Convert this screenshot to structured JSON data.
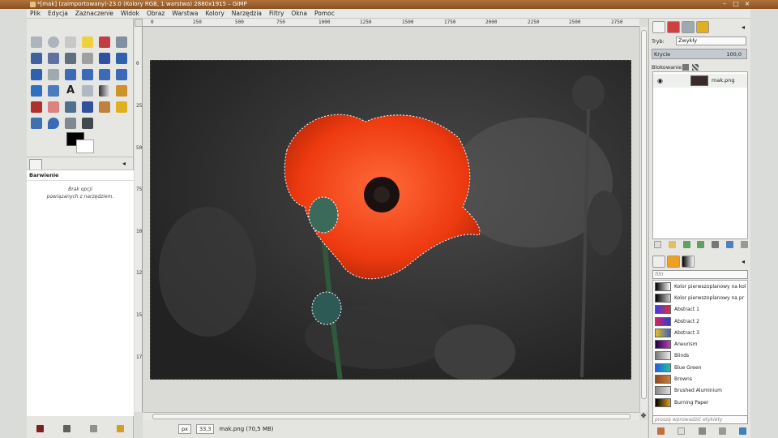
{
  "window": {
    "title": "*[mak] (zaimportowany)-23.0 (Kolory RGB, 1 warstwa) 2880x1915 – GIMP"
  },
  "menu": [
    "Plik",
    "Edycja",
    "Zaznaczenie",
    "Widok",
    "Obraz",
    "Warstwa",
    "Kolory",
    "Narzędzia",
    "Filtry",
    "Okna",
    "Pomoc"
  ],
  "toolbox": {
    "options_title": "Barwienie",
    "options_message_line1": "Brak opcji",
    "options_message_line2": "powiązanych z narzędziem.",
    "fg_color": "#000000",
    "bg_color": "#ffffff"
  },
  "rulers": {
    "top": [
      "0",
      "250",
      "500",
      "750",
      "1000",
      "1250",
      "1500",
      "1750",
      "2000",
      "2250",
      "2500",
      "2750"
    ],
    "left": [
      "0",
      "250",
      "500",
      "750",
      "1000",
      "1250",
      "1500",
      "1750"
    ]
  },
  "status": {
    "unit": "px",
    "zoom": "33,3",
    "file": "mak.png (70,5 MB)"
  },
  "layers": {
    "mode_label": "Tryb:",
    "mode_value": "Zwykły",
    "opacity_label": "Krycie",
    "opacity_value": "100,0",
    "lock_label": "Blokowanie:",
    "items": [
      {
        "name": "mak.png"
      }
    ]
  },
  "gradients": {
    "filter_placeholder": "filtr",
    "tag_placeholder": "proszę wprowadzić etykiety",
    "items": [
      {
        "name": "Kolor pierwszoplanowy na kol",
        "colors": [
          "#000000",
          "#ffffff"
        ]
      },
      {
        "name": "Kolor pierwszoplanowy na pr",
        "colors": [
          "#000000",
          "#cccccc"
        ]
      },
      {
        "name": "Abstract 1",
        "colors": [
          "#3a3af0",
          "#e03030"
        ]
      },
      {
        "name": "Abstract 2",
        "colors": [
          "#e0205a",
          "#2040e0"
        ]
      },
      {
        "name": "Abstract 3",
        "colors": [
          "#e0c020",
          "#4060c0"
        ]
      },
      {
        "name": "Aneurism",
        "colors": [
          "#200040",
          "#c040c0"
        ]
      },
      {
        "name": "Blinds",
        "colors": [
          "#777777",
          "#eeeeee"
        ]
      },
      {
        "name": "Blue Green",
        "colors": [
          "#2060e0",
          "#20c0a0"
        ]
      },
      {
        "name": "Browns",
        "colors": [
          "#8a4a20",
          "#d08040"
        ]
      },
      {
        "name": "Brushed Aluminium",
        "colors": [
          "#8a8a8a",
          "#dcdcdc"
        ]
      },
      {
        "name": "Burning Paper",
        "colors": [
          "#000000",
          "#e0a020"
        ]
      }
    ]
  }
}
